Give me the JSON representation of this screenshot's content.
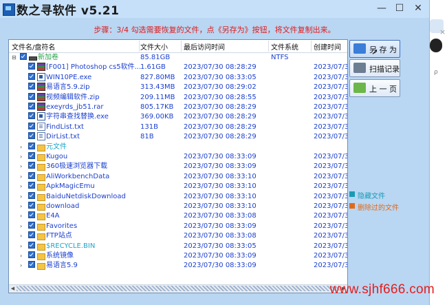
{
  "window": {
    "title": "数之寻软件 v5.21",
    "controls": {
      "minimize": "—",
      "maximize": "☐",
      "close": "✕"
    }
  },
  "step_text": "步骤：3/4 勾选需要恢复的文件，点《另存为》按钮，将文件复制出来。",
  "columns": {
    "name": "文件名/盘符名",
    "size": "文件大小",
    "accessed": "最后访问时间",
    "fs": "文件系统",
    "created": "创建时间"
  },
  "rows": [
    {
      "name": "新加卷",
      "size": "85.81GB",
      "date": "",
      "fs": "NTFS",
      "created": "",
      "icon": "drive",
      "color": "green",
      "expander": "⊟",
      "level": 0
    },
    {
      "name": "[F001] Photoshop cs5软件...",
      "size": "1.61GB",
      "date": "2023/07/30 08:28:29",
      "fs": "",
      "created": "2023/07/3",
      "icon": "rar",
      "color": "blue",
      "expander": "",
      "level": 1
    },
    {
      "name": "WIN10PE.exe",
      "size": "827.80MB",
      "date": "2023/07/30 08:33:05",
      "fs": "",
      "created": "2023/07/3",
      "icon": "exe",
      "color": "blue",
      "expander": "",
      "level": 1
    },
    {
      "name": "易语言5.9.zip",
      "size": "313.43MB",
      "date": "2023/07/30 08:29:02",
      "fs": "",
      "created": "2023/07/3",
      "icon": "rar",
      "color": "blue",
      "expander": "",
      "level": 1
    },
    {
      "name": "视频编辑软件.zip",
      "size": "209.11MB",
      "date": "2023/07/30 08:28:55",
      "fs": "",
      "created": "2023/07/3",
      "icon": "rar",
      "color": "blue",
      "expander": "",
      "level": 1
    },
    {
      "name": "exeyrds_jb51.rar",
      "size": "805.17KB",
      "date": "2023/07/30 08:28:29",
      "fs": "",
      "created": "2023/07/3",
      "icon": "rar",
      "color": "blue",
      "expander": "",
      "level": 1
    },
    {
      "name": "字符串查找替换.exe",
      "size": "369.00KB",
      "date": "2023/07/30 08:28:29",
      "fs": "",
      "created": "2023/07/3",
      "icon": "exe",
      "color": "blue",
      "expander": "",
      "level": 1
    },
    {
      "name": "FindList.txt",
      "size": "131B",
      "date": "2023/07/30 08:28:29",
      "fs": "",
      "created": "2023/07/3",
      "icon": "txt",
      "color": "blue",
      "expander": "",
      "level": 1
    },
    {
      "name": "DirList.txt",
      "size": "81B",
      "date": "2023/07/30 08:28:29",
      "fs": "",
      "created": "2023/07/3",
      "icon": "txt",
      "color": "blue",
      "expander": "",
      "level": 1
    },
    {
      "name": "元文件",
      "size": "",
      "date": "",
      "fs": "",
      "created": "",
      "icon": "folder",
      "color": "cyan",
      "expander": "›",
      "level": 1
    },
    {
      "name": "Kugou",
      "size": "",
      "date": "2023/07/30 08:33:09",
      "fs": "",
      "created": "2023/07/3",
      "icon": "folder",
      "color": "blue",
      "expander": "›",
      "level": 1
    },
    {
      "name": "360极速浏览器下载",
      "size": "",
      "date": "2023/07/30 08:33:09",
      "fs": "",
      "created": "2023/07/3",
      "icon": "folder",
      "color": "blue",
      "expander": "›",
      "level": 1
    },
    {
      "name": "AliWorkbenchData",
      "size": "",
      "date": "2023/07/30 08:33:10",
      "fs": "",
      "created": "2023/07/3",
      "icon": "folder",
      "color": "blue",
      "expander": "›",
      "level": 1
    },
    {
      "name": "ApkMagicEmu",
      "size": "",
      "date": "2023/07/30 08:33:10",
      "fs": "",
      "created": "2023/07/3",
      "icon": "folder",
      "color": "blue",
      "expander": "›",
      "level": 1
    },
    {
      "name": "BaiduNetdiskDownload",
      "size": "",
      "date": "2023/07/30 08:33:10",
      "fs": "",
      "created": "2023/07/3",
      "icon": "folder",
      "color": "blue",
      "expander": "›",
      "level": 1
    },
    {
      "name": "download",
      "size": "",
      "date": "2023/07/30 08:33:10",
      "fs": "",
      "created": "2023/07/3",
      "icon": "folder",
      "color": "blue",
      "expander": "›",
      "level": 1
    },
    {
      "name": "E4A",
      "size": "",
      "date": "2023/07/30 08:33:08",
      "fs": "",
      "created": "2023/07/3",
      "icon": "folder",
      "color": "blue",
      "expander": "›",
      "level": 1
    },
    {
      "name": "Favorites",
      "size": "",
      "date": "2023/07/30 08:33:09",
      "fs": "",
      "created": "2023/07/3",
      "icon": "folder",
      "color": "blue",
      "expander": "›",
      "level": 1
    },
    {
      "name": "FTP站点",
      "size": "",
      "date": "2023/07/30 08:33:08",
      "fs": "",
      "created": "2023/07/3",
      "icon": "folder",
      "color": "blue",
      "expander": "›",
      "level": 1
    },
    {
      "name": "$RECYCLE.BIN",
      "size": "",
      "date": "2023/07/30 08:33:05",
      "fs": "",
      "created": "2023/07/3",
      "icon": "folder",
      "color": "cyan",
      "expander": "›",
      "level": 1
    },
    {
      "name": "系统镜像",
      "size": "",
      "date": "2023/07/30 08:33:09",
      "fs": "",
      "created": "2023/07/3",
      "icon": "folder",
      "color": "blue",
      "expander": "›",
      "level": 1
    },
    {
      "name": "易语言5.9",
      "size": "",
      "date": "2023/07/30 08:33:09",
      "fs": "",
      "created": "2023/07/3",
      "icon": "folder",
      "color": "blue",
      "expander": "›",
      "level": 1
    }
  ],
  "buttons": {
    "save_as": "另 存 为",
    "scan_record": "扫描记录",
    "prev_page": "上 一 页"
  },
  "legend": {
    "hidden": {
      "label": "隐藏文件",
      "color": "#1a9bb5"
    },
    "deleted": {
      "label": "删除过的文件",
      "color": "#e06a1a"
    }
  },
  "scrollbar": {
    "left_arrow": "◀",
    "right_arrow": "▶"
  },
  "sidebar": {
    "close": "×",
    "pin": "ρ"
  },
  "watermark": "www.sjhf666.com"
}
